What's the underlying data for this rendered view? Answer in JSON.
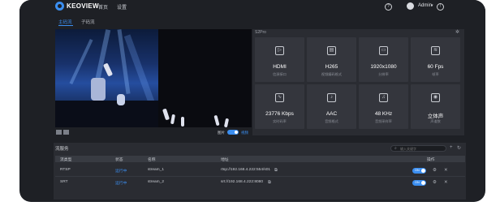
{
  "topbar": {
    "logo_text": "KEOVIEW",
    "nav": [
      "首页",
      "设置"
    ],
    "user": "Admin",
    "caret": "▾",
    "help_glyph": "?",
    "notify_glyph": "!"
  },
  "tabs": [
    {
      "label": "主码流",
      "active": true
    },
    {
      "label": "子码流",
      "active": false
    }
  ],
  "video_bar": {
    "left_label": "图片",
    "right_label": "视频"
  },
  "info_panel": {
    "title": "S2Pro",
    "tiles": [
      {
        "icon": "▷",
        "value": "HDMI",
        "label": "信源接口"
      },
      {
        "icon": "▤",
        "value": "H265",
        "label": "视频编码格式"
      },
      {
        "icon": "▭",
        "value": "1920x1080",
        "label": "分辨率"
      },
      {
        "icon": "≋",
        "value": "60 Fps",
        "label": "帧率"
      },
      {
        "icon": "∿",
        "value": "23776 Kbps",
        "label": "实时码率"
      },
      {
        "icon": "♪",
        "value": "AAC",
        "label": "音频格式"
      },
      {
        "icon": "♫",
        "value": "48 KHz",
        "label": "音频采样率"
      },
      {
        "icon": "◉",
        "value": "立体声",
        "label": "声道数"
      }
    ]
  },
  "streams": {
    "title": "流服务",
    "search_placeholder": "输入关键字",
    "columns": [
      "流类型",
      "状态",
      "名称",
      "地址",
      "操作"
    ],
    "rows": [
      {
        "type": "RTSP",
        "status": "运行中",
        "name": "stream_1",
        "address": "rtsp://192.168.4.222:554/s01",
        "toggle": "ON"
      },
      {
        "type": "SRT",
        "status": "运行中",
        "name": "stream_2",
        "address": "srt://192.168.4.222:8080",
        "toggle": "ON"
      }
    ]
  },
  "colors": {
    "accent": "#3b8ef0",
    "background": "#1e2025",
    "panel": "#2a2c32"
  }
}
